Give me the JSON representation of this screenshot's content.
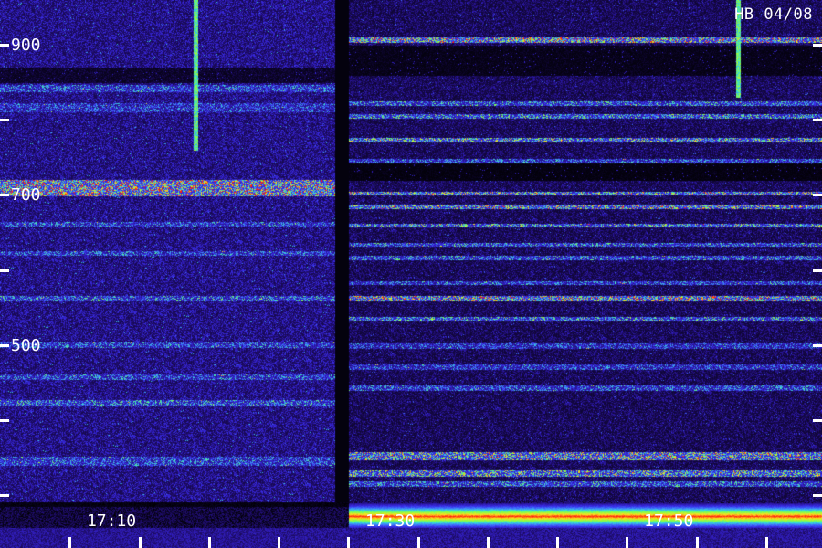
{
  "chart_data": {
    "type": "heatmap",
    "title": "",
    "station_label": "HB 04/08",
    "xlabel": "",
    "ylabel": "",
    "x_axis": {
      "tick_labels": [
        {
          "label": "17:10",
          "at": "17:10"
        },
        {
          "label": "17:30",
          "at": "17:30"
        },
        {
          "label": "17:50",
          "at": "17:50"
        }
      ],
      "range": [
        "17:02",
        "18:01"
      ],
      "minor_ticks_per_label": 4,
      "gap": [
        "17:26",
        "17:27"
      ]
    },
    "y_axis": {
      "tick_labels": [
        {
          "label": "900",
          "value": 900
        },
        {
          "label": "700",
          "value": 700
        },
        {
          "label": "500",
          "value": 500
        }
      ],
      "major_step": 100,
      "range": [
        290,
        960
      ]
    },
    "colormap": [
      "#000000",
      "#1a0a5a",
      "#2e1ab0",
      "#3a2ee8",
      "#3f7cff",
      "#38e0d0",
      "#8cff40",
      "#ffe020",
      "#ff2010"
    ],
    "grid": false,
    "legend": "none",
    "features": [
      {
        "name": "vertical-streak",
        "at": "17:16",
        "freq_range": [
          760,
          960
        ]
      },
      {
        "name": "vertical-streak",
        "at": "17:55",
        "freq_range": [
          830,
          960
        ]
      },
      {
        "name": "strong-low-band",
        "from": "17:27",
        "to": "18:01",
        "freq_range": [
          290,
          305
        ]
      }
    ],
    "bands": [
      {
        "segment": "left",
        "freq": [
          838,
          846
        ],
        "level": 0.55
      },
      {
        "segment": "left",
        "freq": [
          812,
          822
        ],
        "level": 0.5
      },
      {
        "segment": "left",
        "freq": [
          700,
          720
        ],
        "level": 0.9
      },
      {
        "segment": "left",
        "freq": [
          660,
          664
        ],
        "level": 0.55
      },
      {
        "segment": "left",
        "freq": [
          620,
          624
        ],
        "level": 0.55
      },
      {
        "segment": "left",
        "freq": [
          560,
          565
        ],
        "level": 0.6
      },
      {
        "segment": "left",
        "freq": [
          498,
          503
        ],
        "level": 0.55
      },
      {
        "segment": "left",
        "freq": [
          455,
          460
        ],
        "level": 0.55
      },
      {
        "segment": "left",
        "freq": [
          420,
          426
        ],
        "level": 0.6
      },
      {
        "segment": "left",
        "freq": [
          340,
          350
        ],
        "level": 0.55
      },
      {
        "segment": "right",
        "freq": [
          904,
          910
        ],
        "level": 0.85
      },
      {
        "segment": "right",
        "freq": [
          820,
          824
        ],
        "level": 0.6
      },
      {
        "segment": "right",
        "freq": [
          803,
          807
        ],
        "level": 0.65
      },
      {
        "segment": "right",
        "freq": [
          772,
          776
        ],
        "level": 0.75
      },
      {
        "segment": "right",
        "freq": [
          744,
          748
        ],
        "level": 0.55
      },
      {
        "segment": "right",
        "freq": [
          701,
          704
        ],
        "level": 0.8
      },
      {
        "segment": "right",
        "freq": [
          683,
          687
        ],
        "level": 0.8
      },
      {
        "segment": "right",
        "freq": [
          658,
          661
        ],
        "level": 0.7
      },
      {
        "segment": "right",
        "freq": [
          633,
          636
        ],
        "level": 0.6
      },
      {
        "segment": "right",
        "freq": [
          614,
          618
        ],
        "level": 0.6
      },
      {
        "segment": "right",
        "freq": [
          581,
          584
        ],
        "level": 0.55
      },
      {
        "segment": "right",
        "freq": [
          560,
          565
        ],
        "level": 0.85
      },
      {
        "segment": "right",
        "freq": [
          533,
          537
        ],
        "level": 0.65
      },
      {
        "segment": "right",
        "freq": [
          496,
          502
        ],
        "level": 0.5
      },
      {
        "segment": "right",
        "freq": [
          468,
          473
        ],
        "level": 0.5
      },
      {
        "segment": "right",
        "freq": [
          440,
          446
        ],
        "level": 0.55
      },
      {
        "segment": "right",
        "freq": [
          348,
          356
        ],
        "level": 0.8
      },
      {
        "segment": "right",
        "freq": [
          326,
          332
        ],
        "level": 0.75
      },
      {
        "segment": "right",
        "freq": [
          312,
          318
        ],
        "level": 0.6
      }
    ]
  }
}
